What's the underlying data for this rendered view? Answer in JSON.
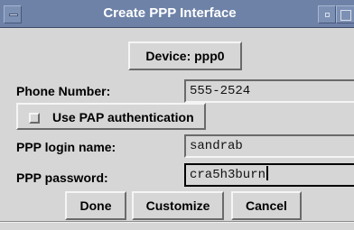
{
  "window": {
    "title": "Create PPP Interface"
  },
  "device_button": {
    "label": "Device: ppp0"
  },
  "form": {
    "phone_label": "Phone Number:",
    "phone_value": "555-2524",
    "pap_label": "Use PAP authentication",
    "pap_checked": false,
    "login_label": "PPP login name:",
    "login_value": "sandrab",
    "password_label": "PPP password:",
    "password_value": "cra5h3burn"
  },
  "actions": {
    "done": "Done",
    "customize": "Customize",
    "cancel": "Cancel"
  }
}
